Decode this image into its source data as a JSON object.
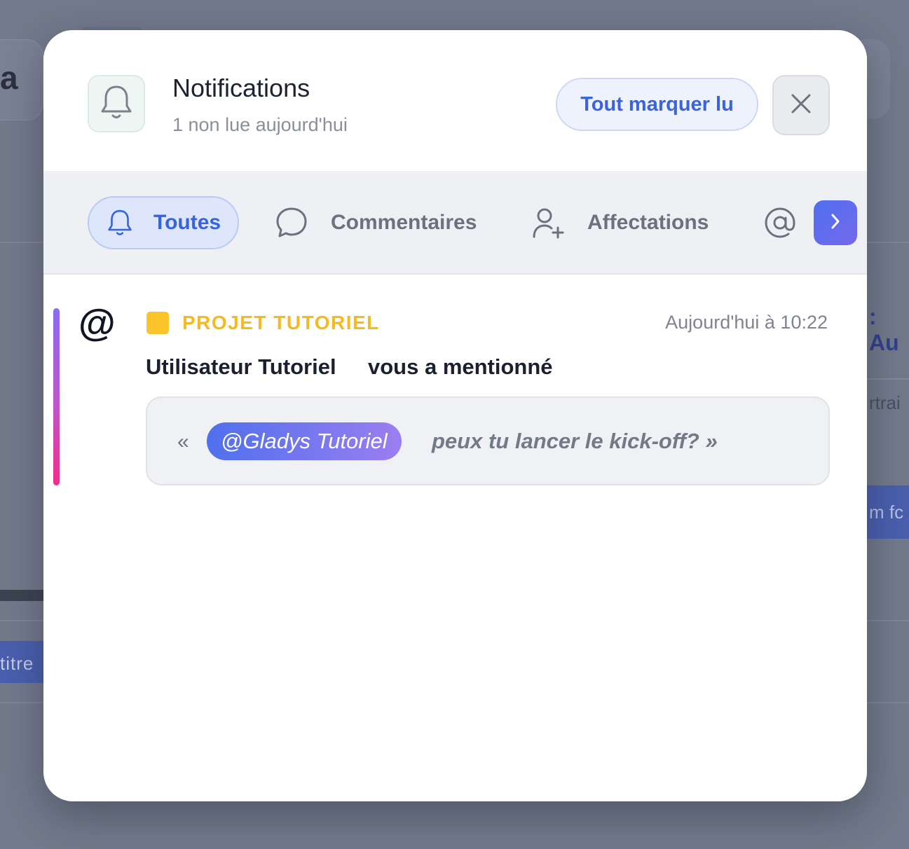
{
  "modal": {
    "title": "Notifications",
    "subtitle": "1 non lue aujourd'hui",
    "mark_all_read_label": "Tout marquer lu",
    "close_icon": "close-icon",
    "header_icon": "bell-icon"
  },
  "tabs": [
    {
      "label": "Toutes",
      "icon": "bell-icon",
      "active": true
    },
    {
      "label": "Commentaires",
      "icon": "comment-icon",
      "active": false
    },
    {
      "label": "Affectations",
      "icon": "user-plus-icon",
      "active": false
    },
    {
      "label": "",
      "icon": "at-icon",
      "active": false
    }
  ],
  "tabs_next_icon": "chevron-right-icon",
  "notifications": [
    {
      "type_icon": "@",
      "project": "PROJET TUTORIEL",
      "project_color": "#fbc42d",
      "time": "Aujourd'hui à 10:22",
      "actor": "Utilisateur Tutoriel",
      "action": "vous a mentionné",
      "quote_open": "«",
      "mention": "@Gladys Tutoriel",
      "quote_text": "peux tu lancer le kick-off? »",
      "unread": true
    }
  ],
  "background": {
    "left_letter": "a",
    "left_button_text": "titre",
    "right_label": ": Au",
    "right_faded_text": "rtrai",
    "right_button_text": "m fc"
  },
  "colors": {
    "accent": "#3b63e0",
    "project": "#fbc42d",
    "overlay": "#727a8b"
  }
}
